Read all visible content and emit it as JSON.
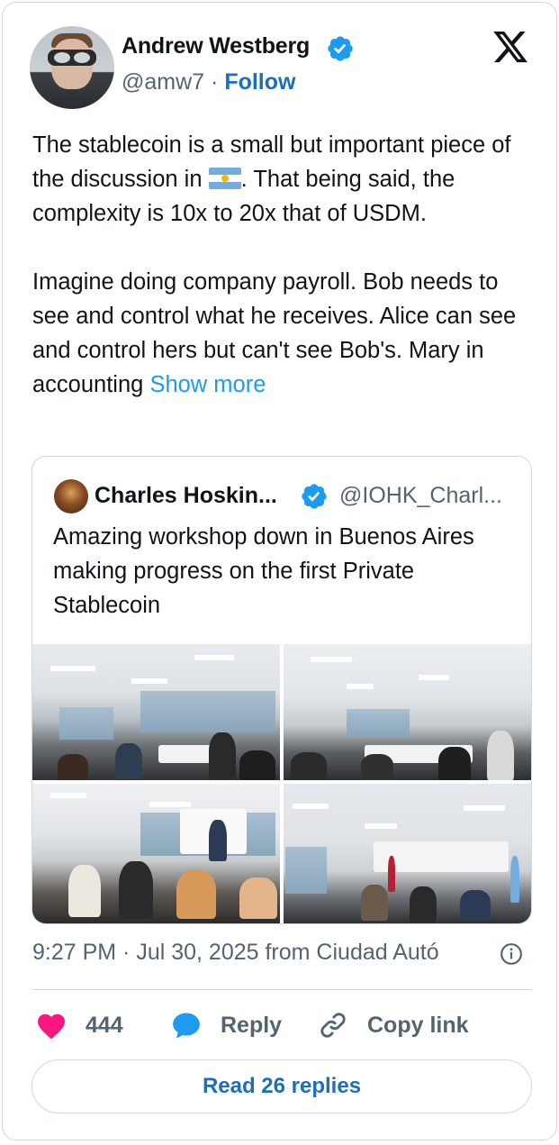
{
  "author": {
    "name": "Andrew Westberg",
    "handle": "@amw7",
    "separator": "·",
    "follow_label": "Follow",
    "verified": true
  },
  "tweet": {
    "paragraph1_before_flag": "The stablecoin is a small but important piece of the discussion in ",
    "flag_emoji": "argentina-flag",
    "paragraph1_after_flag": ". That being said, the complexity is 10x to 20x that of USDM.",
    "paragraph2": "Imagine doing company payroll. Bob needs to see and control what he receives. Alice can see and control hers but can't see Bob's. Mary in accounting ",
    "show_more_label": "Show more"
  },
  "quote": {
    "name": "Charles Hoskin...",
    "handle": "@IOHK_Charl...",
    "verified": true,
    "text": "Amazing workshop down in Buenos Aires making progress on the first Private Stablecoin"
  },
  "timestamp": "9:27 PM · Jul 30, 2025 from Ciudad Autó",
  "actions": {
    "likes": "444",
    "reply_label": "Reply",
    "copy_label": "Copy link"
  },
  "read_replies_label": "Read 26 replies",
  "colors": {
    "accent_blue": "#1d9bf0",
    "link_blue": "#1d6fb8",
    "like_pink": "#f91880",
    "muted": "#536471",
    "border": "#cfd9de"
  },
  "icons": [
    "verified-badge-icon",
    "x-logo-icon",
    "info-icon",
    "heart-icon",
    "reply-bubble-icon",
    "link-icon"
  ]
}
